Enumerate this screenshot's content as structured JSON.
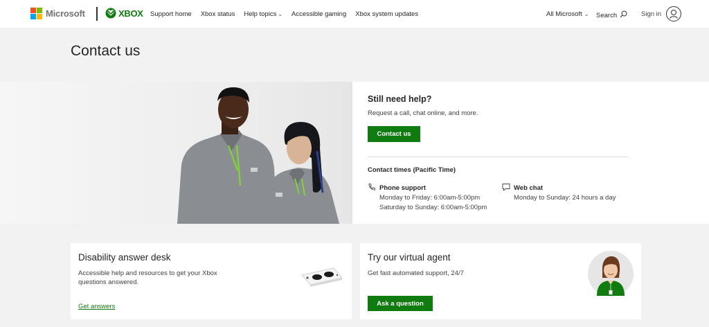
{
  "header": {
    "brand": "Microsoft",
    "xbox_brand": "XBOX",
    "nav": [
      {
        "label": "Support home"
      },
      {
        "label": "Xbox status"
      },
      {
        "label": "Help topics",
        "has_dropdown": true
      },
      {
        "label": "Accessible gaming"
      },
      {
        "label": "Xbox system updates"
      }
    ],
    "all_microsoft": "All Microsoft",
    "search": "Search",
    "sign_in": "Sign in"
  },
  "page": {
    "title": "Contact us"
  },
  "help": {
    "title": "Still need help?",
    "subtitle": "Request a call, chat online, and more.",
    "button": "Contact us",
    "times_title": "Contact times (Pacific Time)",
    "phone": {
      "icon": "phone-icon",
      "title": "Phone support",
      "lines": [
        "Monday to Friday: 6:00am-5:00pm",
        "Saturday to Sunday: 6:00am-5:00pm"
      ]
    },
    "chat": {
      "icon": "chat-icon",
      "title": "Web chat",
      "lines": [
        "Monday to Sunday: 24 hours a day"
      ]
    }
  },
  "cards": {
    "disability": {
      "title": "Disability answer desk",
      "desc_lines": [
        "Accessible help and resources to get your Xbox",
        "questions answered."
      ],
      "link": "Get answers"
    },
    "agent": {
      "title": "Try our virtual agent",
      "desc": "Get fast automated support, 24/7",
      "button": "Ask a question"
    }
  },
  "colors": {
    "xbox_green": "#107c10",
    "neon_green": "#7fd13b",
    "page_bg": "#f2f2f2",
    "ms_red": "#f25022",
    "ms_green": "#7fba00",
    "ms_blue": "#00a4ef",
    "ms_yellow": "#ffb900"
  }
}
